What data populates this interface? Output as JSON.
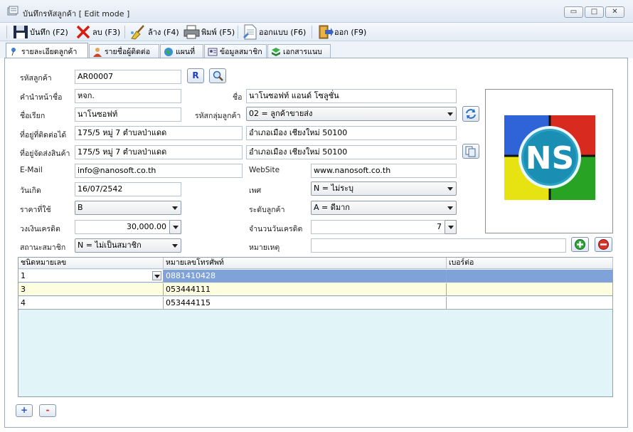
{
  "window": {
    "title": "บันทึกรหัสลูกค้า [ Edit mode ]"
  },
  "toolbar": {
    "save": "บันทึก (F2)",
    "delete": "ลบ (F3)",
    "clear": "ล้าง (F4)",
    "print": "พิมพ์ (F5)",
    "design": "ออกแบบ (F6)",
    "exit": "ออก (F9)"
  },
  "tabs": [
    "รายละเอียดลูกค้า",
    "รายชื่อผู้ติดต่อ",
    "แผนที่",
    "ข้อมูลสมาชิก",
    "เอกสารแนบ"
  ],
  "form": {
    "customer_code_label": "รหัสลูกค้า",
    "customer_code": "AR00007",
    "r_button": "R",
    "prefix_label": "คำนำหน้าชื่อ",
    "prefix": "หจก.",
    "name_label": "ชื่อ",
    "name": "นาโนซอฟท์ แอนด์ โซลูชั่น",
    "nickname_label": "ชื่อเรียก",
    "nickname": "นาโนซอฟท์",
    "group_label": "รหัสกลุ่มลูกค้า",
    "group": "02 = ลูกค้าขายส่ง",
    "contact_addr_label": "ที่อยู่ที่ติดต่อได้",
    "contact_addr1": "175/5 หมู่ 7 ตำบลป่าแดด",
    "contact_addr2": "อำเภอเมือง เชียงใหม่ 50100",
    "ship_addr_label": "ที่อยู่จัดส่งสินค้า",
    "ship_addr1": "175/5 หมู่ 7 ตำบลป่าแดด",
    "ship_addr2": "อำเภอเมือง เชียงใหม่ 50100",
    "email_label": "E-Mail",
    "email": "info@nanosoft.co.th",
    "website_label": "WebSite",
    "website": "www.nanosoft.co.th",
    "birthdate_label": "วันเกิด",
    "birthdate": "16/07/2542",
    "gender_label": "เพศ",
    "gender": "N = ไม่ระบุ",
    "price_label": "ราคาที่ใช้",
    "price": "B",
    "level_label": "ระดับลูกค้า",
    "level": "A = ดีมาก",
    "credit_label": "วงเงินเครดิต",
    "credit": "30,000.00",
    "credit_days_label": "จำนวนวันเครดิต",
    "credit_days": "7",
    "member_label": "สถานะสมาชิก",
    "member": "N = ไม่เป็นสมาชิก",
    "note_label": "หมายเหตุ",
    "note": ""
  },
  "logo_text": "NS",
  "grid": {
    "columns": [
      "ชนิดหมายเลข",
      "หมายเลขโทรศัพท์",
      "เบอร์ต่อ"
    ],
    "rows": [
      {
        "type": "1",
        "phone": "0881410428",
        "ext": ""
      },
      {
        "type": "3",
        "phone": "053444111",
        "ext": ""
      },
      {
        "type": "4",
        "phone": "053444115",
        "ext": ""
      }
    ]
  },
  "bottom": {
    "add": "+",
    "remove": "-"
  },
  "colors": {
    "selected_row": "#7fa2d8",
    "alt_row": "#fdfde0",
    "grid_bg": "#e1f5f9"
  }
}
